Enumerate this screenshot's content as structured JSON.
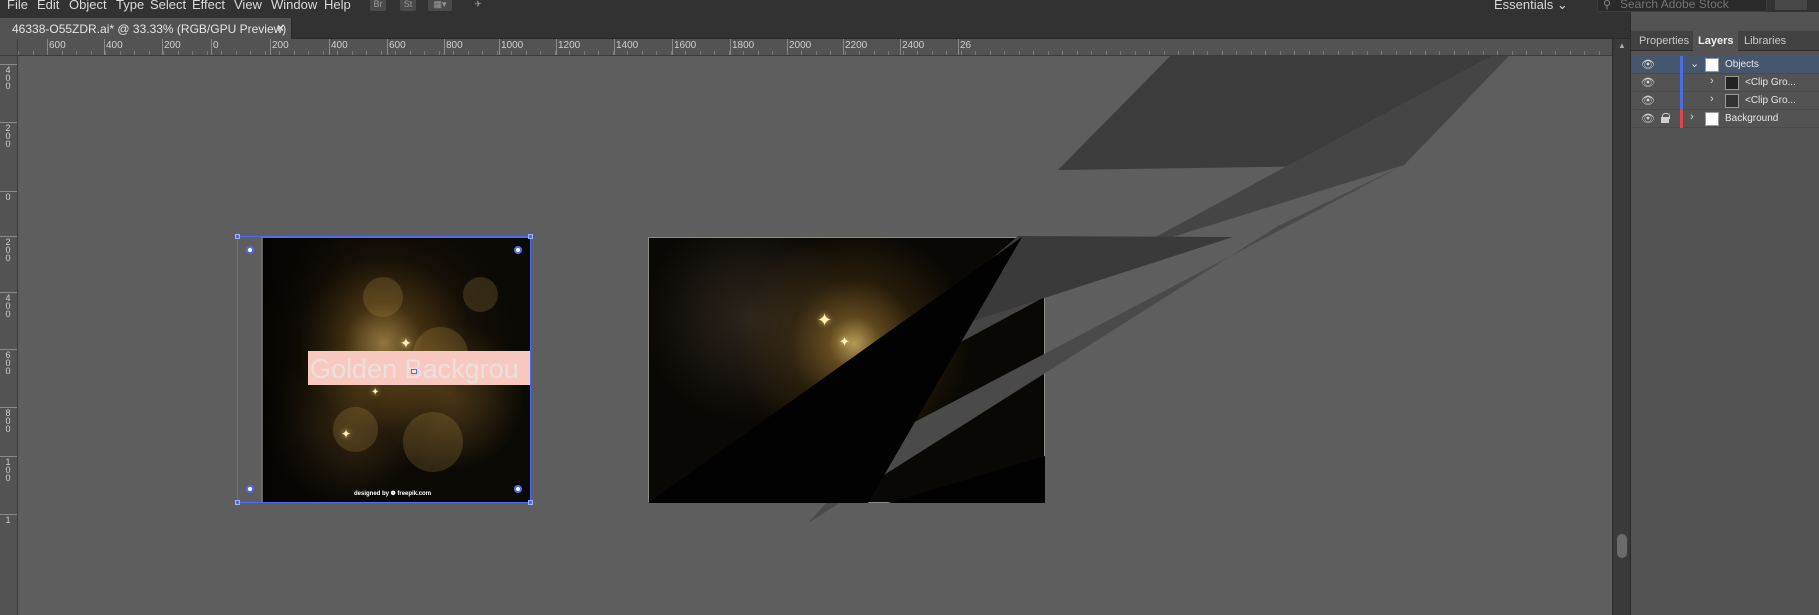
{
  "menu": {
    "items": [
      "File",
      "Edit",
      "Object",
      "Type",
      "Select",
      "Effect",
      "View",
      "Window",
      "Help"
    ],
    "toolbar_icons": [
      "Br",
      "St"
    ],
    "workspace": "Essentials",
    "search_placeholder": "Search Adobe Stock"
  },
  "document": {
    "tab_title": "46338-O55ZDR.ai* @ 33.33% (RGB/GPU Preview)",
    "close": "×"
  },
  "ruler": {
    "top_labels": [
      "600",
      "400",
      "200",
      "0",
      "200",
      "400",
      "600",
      "800",
      "1000",
      "1200",
      "1400",
      "1600",
      "1800",
      "2000",
      "2200",
      "2400",
      "26"
    ],
    "left_labels": [
      [
        "4",
        "0",
        "0"
      ],
      [
        "2",
        "0",
        "0"
      ],
      [
        "0"
      ],
      [
        "2",
        "0",
        "0"
      ],
      [
        "4",
        "0",
        "0"
      ],
      [
        "6",
        "0",
        "0"
      ],
      [
        "8",
        "0",
        "0"
      ],
      [
        "1",
        "0",
        "0"
      ],
      [
        "1"
      ]
    ]
  },
  "artboard1": {
    "headline": "Golden Backgrou",
    "credit": "designed by ❁ freepik.com"
  },
  "panel": {
    "tabs": [
      "Properties",
      "Layers",
      "Libraries"
    ],
    "active_tab": "Layers",
    "layers": [
      {
        "name": "Objects",
        "color": "#4a6ee0",
        "expanded": true,
        "selected": true
      },
      {
        "name": "<Clip Gro...",
        "color": "#4a6ee0",
        "expanded": false,
        "selected": false
      },
      {
        "name": "<Clip Gro...",
        "color": "#4a6ee0",
        "expanded": false,
        "selected": false
      },
      {
        "name": "Background",
        "color": "#e04848",
        "expanded": false,
        "selected": false,
        "locked": true
      }
    ]
  },
  "colors": {
    "selection": "#4e6cf0",
    "panel_bg": "#535353",
    "canvas_bg": "#5e5e5e"
  }
}
